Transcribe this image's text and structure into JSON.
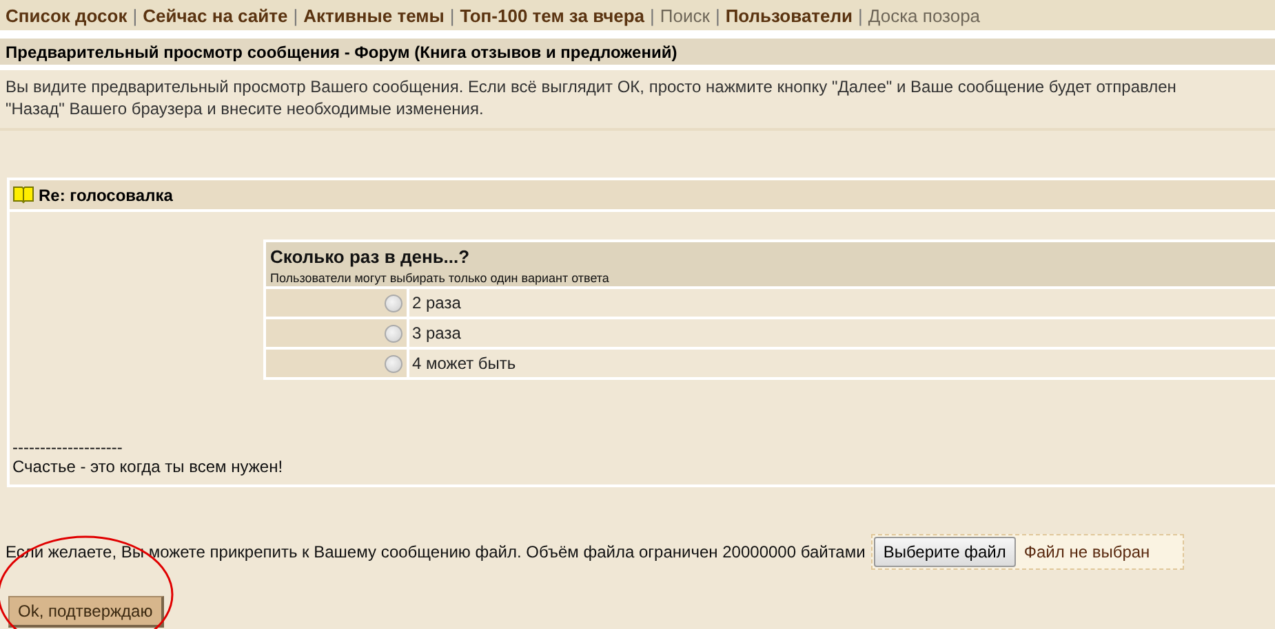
{
  "nav": [
    {
      "label": "Список досок",
      "kind": "strong"
    },
    {
      "label": "Сейчас на сайте",
      "kind": "strong"
    },
    {
      "label": "Активные темы",
      "kind": "strong"
    },
    {
      "label": "Топ-100 тем за вчера",
      "kind": "strong"
    },
    {
      "label": "Поиск",
      "kind": "plain"
    },
    {
      "label": "Пользователи",
      "kind": "strong"
    },
    {
      "label": "Доска позора",
      "kind": "plain"
    }
  ],
  "separator": "|",
  "page_title": "Предварительный просмотр сообщения - Форум (Книга отзывов и предложений)",
  "intro": [
    "Вы видите предварительный просмотр Вашего сообщения. Если всё выглядит ОК, просто нажмите кнопку \"Далее\" и Ваше сообщение будет отправлен",
    "\"Назад\" Вашего браузера и внесите необходимые изменения."
  ],
  "post": {
    "subject": "Re: голосовалка",
    "poll": {
      "question": "Сколько раз в день...?",
      "note": "Пользователи могут выбирать только один вариант ответа",
      "options": [
        {
          "label": "2 раза",
          "selected": false
        },
        {
          "label": "3 раза",
          "selected": false
        },
        {
          "label": "4 может быть",
          "selected": false
        }
      ]
    },
    "signature_rule": "--------------------",
    "signature": "Счастье - это когда ты всем нужен!"
  },
  "attach": {
    "text": "Если желаете, Вы можете прикрепить к Вашему сообщению файл. Объём файла ограничен 20000000 байтами",
    "button": "Выберите файл",
    "status": "Файл не выбран"
  },
  "submit": "Ok, подтверждаю"
}
